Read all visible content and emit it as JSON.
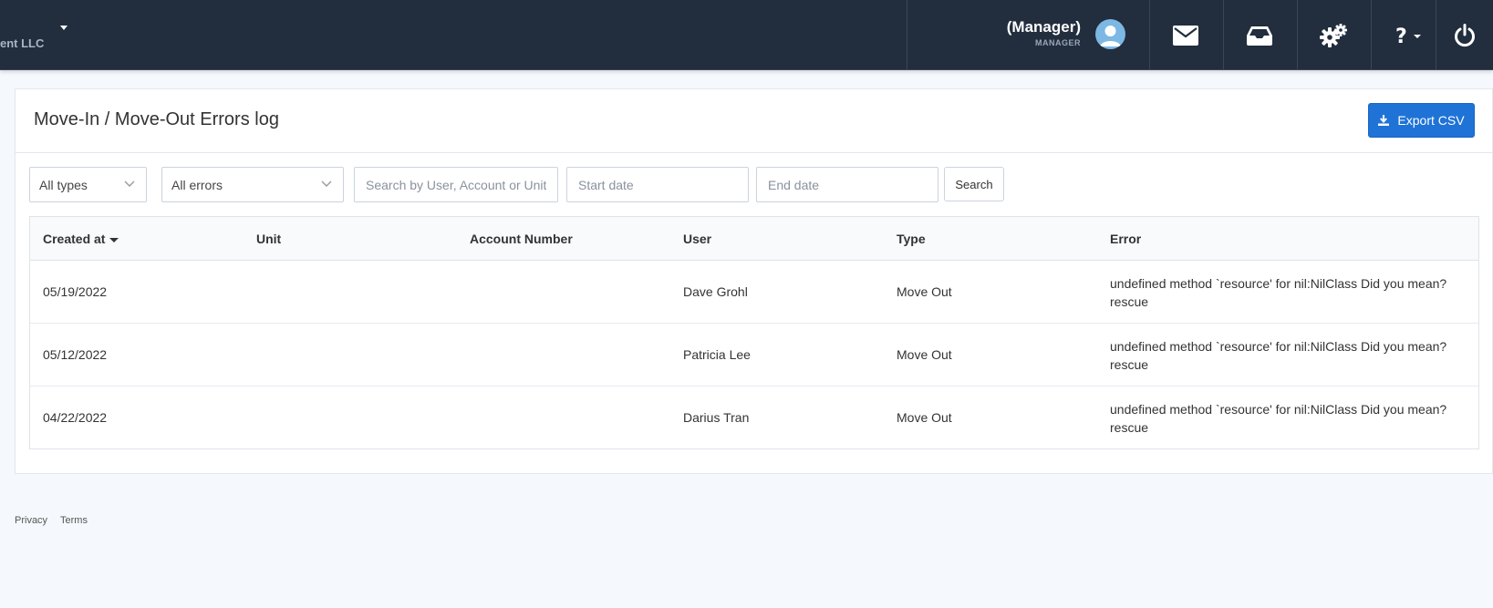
{
  "navbar": {
    "brand_text": "ent LLC",
    "user_name": "(Manager)",
    "user_role": "MANAGER"
  },
  "page": {
    "title": "Move-In / Move-Out Errors log",
    "export_label": "Export CSV"
  },
  "filters": {
    "types_selected": "All types",
    "errors_selected": "All errors",
    "search_placeholder": "Search by User, Account or Unit",
    "start_placeholder": "Start date",
    "end_placeholder": "End date",
    "search_label": "Search"
  },
  "table": {
    "headers": {
      "created": "Created at",
      "unit": "Unit",
      "account": "Account Number",
      "user": "User",
      "type": "Type",
      "error": "Error"
    },
    "rows": [
      {
        "created": "05/19/2022",
        "unit": "",
        "account": "",
        "user": "Dave Grohl",
        "type": "Move Out",
        "error": "undefined method `resource' for nil:NilClass Did you mean? rescue"
      },
      {
        "created": "05/12/2022",
        "unit": "",
        "account": "",
        "user": "Patricia Lee",
        "type": "Move Out",
        "error": "undefined method `resource' for nil:NilClass Did you mean? rescue"
      },
      {
        "created": "04/22/2022",
        "unit": "",
        "account": "",
        "user": "Darius Tran",
        "type": "Move Out",
        "error": "undefined method `resource' for nil:NilClass Did you mean? rescue"
      }
    ]
  },
  "footer": {
    "privacy": "Privacy",
    "terms": "Terms"
  },
  "colors": {
    "navbar_bg": "#222d3e",
    "accent": "#1f73d6",
    "page_bg": "#f5f8fc"
  }
}
